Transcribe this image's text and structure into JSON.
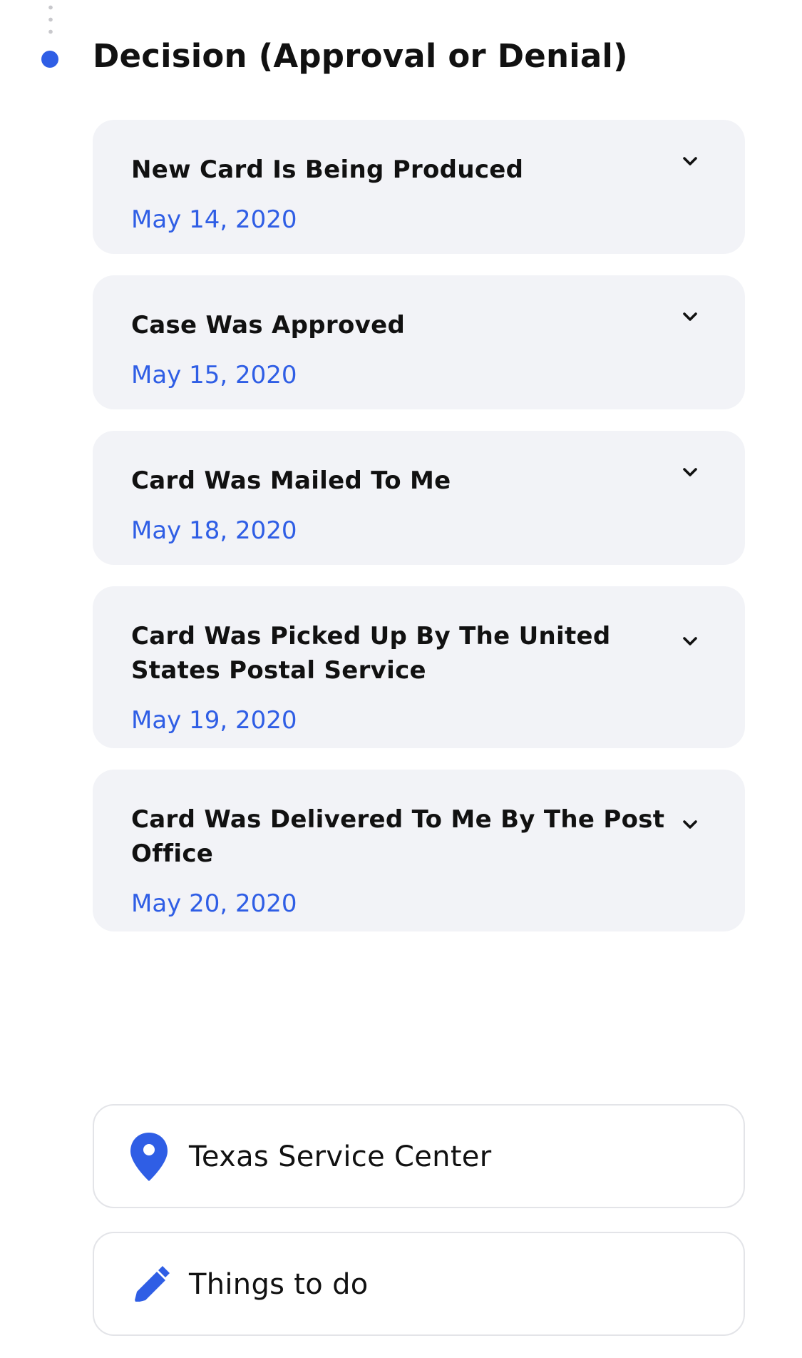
{
  "section": {
    "title": "Decision (Approval or Denial)"
  },
  "events": [
    {
      "title": "New Card Is Being Produced",
      "date": "May 14, 2020"
    },
    {
      "title": "Case Was Approved",
      "date": "May 15, 2020"
    },
    {
      "title": "Card Was Mailed To Me",
      "date": "May 18, 2020"
    },
    {
      "title": "Card Was Picked Up By The United States Postal Service",
      "date": "May 19, 2020"
    },
    {
      "title": "Card Was Delivered To Me By The Post Office",
      "date": "May 20, 2020"
    }
  ],
  "location": {
    "label": "Texas Service Center",
    "icon": "location-pin-icon"
  },
  "todo": {
    "label": "Things to do",
    "icon": "pencil-icon"
  },
  "colors": {
    "accent": "#2f5ee5",
    "card_bg": "#f2f3f7",
    "text": "#111111"
  }
}
